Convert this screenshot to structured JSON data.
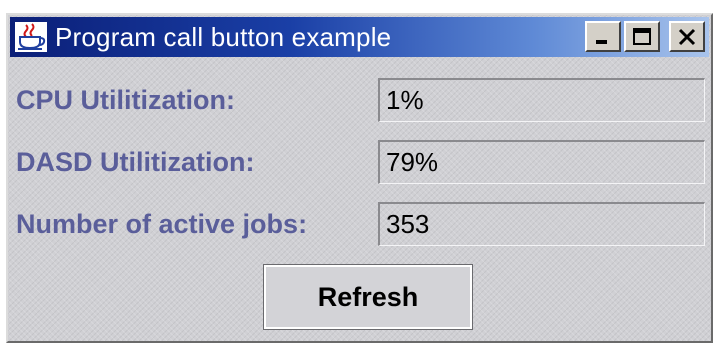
{
  "window": {
    "title": "Program call button example",
    "title_icon": "java-coffee-cup-icon",
    "controls": [
      "minimize-icon",
      "maximize-icon",
      "close-icon"
    ]
  },
  "fields": [
    {
      "label": "CPU Utilitization:",
      "value": "1%"
    },
    {
      "label": "DASD Utilitization:",
      "value": "79%"
    },
    {
      "label": "Number of active jobs:",
      "value": "353"
    }
  ],
  "refresh_button": {
    "label": "Refresh"
  },
  "colors": {
    "label_text": "#5a5e9a",
    "titlebar_start": "#0b1f78",
    "titlebar_end": "#a9c4ec",
    "panel_bg": "#d0d0d4"
  }
}
